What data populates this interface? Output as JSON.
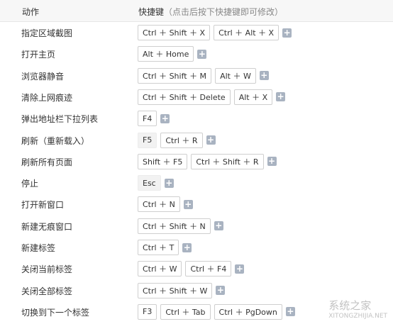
{
  "header": {
    "action_label": "动作",
    "keys_label": "快捷键",
    "keys_hint": "（点击后按下快捷键即可修改）"
  },
  "rows": [
    {
      "label": "指定区域截图",
      "keys": [
        {
          "text": "Ctrl ＋ Shift ＋ X"
        },
        {
          "text": "Ctrl ＋ Alt ＋ X"
        }
      ]
    },
    {
      "label": "打开主页",
      "keys": [
        {
          "text": "Alt ＋ Home"
        }
      ]
    },
    {
      "label": "浏览器静音",
      "keys": [
        {
          "text": "Ctrl ＋ Shift ＋ M"
        },
        {
          "text": "Alt ＋ W"
        }
      ]
    },
    {
      "label": "清除上网痕迹",
      "keys": [
        {
          "text": "Ctrl ＋ Shift ＋ Delete"
        },
        {
          "text": "Alt ＋ X"
        }
      ]
    },
    {
      "label": "弹出地址栏下拉列表",
      "keys": [
        {
          "text": "F4"
        }
      ]
    },
    {
      "label": "刷新（重新载入）",
      "keys": [
        {
          "text": "F5",
          "filled": true
        },
        {
          "text": "Ctrl ＋ R"
        }
      ]
    },
    {
      "label": "刷新所有页面",
      "keys": [
        {
          "text": "Shift ＋ F5"
        },
        {
          "text": "Ctrl ＋ Shift ＋ R"
        }
      ]
    },
    {
      "label": "停止",
      "keys": [
        {
          "text": "Esc",
          "filled": true
        }
      ]
    },
    {
      "label": "打开新窗口",
      "keys": [
        {
          "text": "Ctrl ＋ N"
        }
      ]
    },
    {
      "label": "新建无痕窗口",
      "keys": [
        {
          "text": "Ctrl ＋ Shift ＋ N"
        }
      ]
    },
    {
      "label": "新建标签",
      "keys": [
        {
          "text": "Ctrl ＋ T"
        }
      ]
    },
    {
      "label": "关闭当前标签",
      "keys": [
        {
          "text": "Ctrl ＋ W"
        },
        {
          "text": "Ctrl ＋ F4"
        }
      ]
    },
    {
      "label": "关闭全部标签",
      "keys": [
        {
          "text": "Ctrl ＋ Shift ＋ W"
        }
      ]
    },
    {
      "label": "切换到下一个标签",
      "keys": [
        {
          "text": "F3"
        },
        {
          "text": "Ctrl ＋ Tab"
        },
        {
          "text": "Ctrl ＋ PgDown"
        }
      ]
    }
  ],
  "add_icon": "plus-icon",
  "watermark": {
    "text": "系统之家",
    "sub": "XITONGZHIJIA.NET"
  }
}
